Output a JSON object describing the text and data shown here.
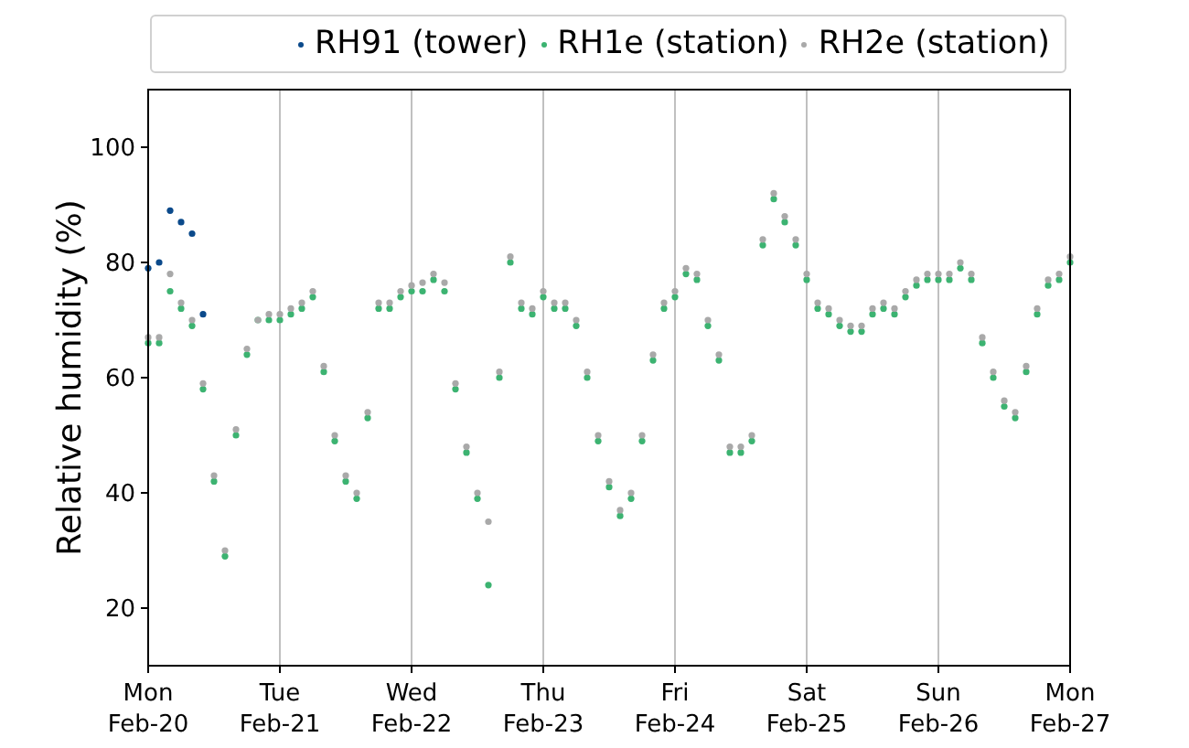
{
  "chart": {
    "chart_data": {
      "type": "scatter",
      "grid": "x",
      "legend": "top",
      "ylabel": "Relative humidity (%)",
      "categories": [
        "Mon\nFeb-20",
        null,
        null,
        null,
        null,
        null,
        null,
        null,
        null,
        null,
        null,
        null,
        "Tue\nFeb-21",
        null,
        null,
        null,
        null,
        null,
        null,
        null,
        null,
        null,
        null,
        null,
        "Wed\nFeb-22",
        null,
        null,
        null,
        null,
        null,
        null,
        null,
        null,
        null,
        null,
        null,
        "Thu\nFeb-23",
        null,
        null,
        null,
        null,
        null,
        null,
        null,
        null,
        null,
        null,
        null,
        "Fri\nFeb-24",
        null,
        null,
        null,
        null,
        null,
        null,
        null,
        null,
        null,
        null,
        null,
        "Sat\nFeb-25",
        null,
        null,
        null,
        null,
        null,
        null,
        null,
        null,
        null,
        null,
        null,
        "Sun\nFeb-26",
        null,
        null,
        null,
        null,
        null,
        null,
        null,
        null,
        null,
        null,
        null,
        "Mon\nFeb-27"
      ],
      "ylim": [
        10,
        110
      ],
      "yticks": [
        20,
        40,
        60,
        80,
        100
      ],
      "series": [
        {
          "name": "RH91 (tower)",
          "color": "#0b4a8b",
          "values": [
            79,
            80,
            89,
            87,
            85,
            71,
            null,
            null,
            null,
            null,
            null,
            null,
            null,
            null,
            null,
            null,
            null,
            null,
            null,
            null,
            null,
            null,
            null,
            null,
            null,
            null,
            null,
            null,
            null,
            null,
            null,
            null,
            null,
            null,
            null,
            null,
            null,
            null,
            null,
            null,
            null,
            null,
            null,
            null,
            null,
            null,
            null,
            null,
            null,
            null,
            null,
            null,
            null,
            null,
            null,
            null,
            null,
            null,
            null,
            null,
            null,
            null,
            null,
            null,
            null,
            null,
            null,
            null,
            null,
            null,
            null,
            null,
            null,
            null,
            null,
            null,
            null,
            null,
            null,
            null,
            null,
            null,
            null,
            null,
            null
          ]
        },
        {
          "name": "RH1e (station)",
          "color": "#3cb371",
          "values": [
            66,
            66,
            75,
            72,
            69,
            58,
            42,
            29,
            50,
            64,
            70,
            70,
            70,
            71,
            72,
            74,
            61,
            49,
            42,
            39,
            53,
            72,
            72,
            74,
            75,
            75,
            77,
            75,
            58,
            47,
            39,
            24,
            60,
            80,
            72,
            71,
            74,
            72,
            72,
            69,
            60,
            49,
            41,
            36,
            39,
            49,
            63,
            72,
            74,
            78,
            77,
            69,
            63,
            47,
            47,
            49,
            83,
            91,
            87,
            83,
            77,
            72,
            71,
            69,
            68,
            68,
            71,
            72,
            71,
            74,
            76,
            77,
            77,
            77,
            79,
            77,
            66,
            60,
            55,
            53,
            61,
            71,
            76,
            77,
            80
          ]
        },
        {
          "name": "RH2e (station)",
          "color": "#a9a9a9",
          "values": [
            67,
            67,
            78,
            73,
            70,
            59,
            43,
            30,
            51,
            65,
            70,
            71,
            71,
            72,
            73,
            75,
            62,
            50,
            43,
            40,
            54,
            73,
            73,
            75,
            76,
            76.5,
            78,
            76.5,
            59,
            48,
            40,
            35,
            61,
            81,
            73,
            72,
            75,
            73,
            73,
            70,
            61,
            50,
            42,
            37,
            40,
            50,
            64,
            73,
            75,
            79,
            78,
            70,
            64,
            48,
            48,
            50,
            84,
            92,
            88,
            84,
            78,
            73,
            72,
            70,
            69,
            69,
            72,
            73,
            72,
            75,
            77,
            78,
            78,
            78,
            80,
            78,
            67,
            61,
            56,
            54,
            62,
            72,
            77,
            78,
            81
          ]
        }
      ]
    }
  }
}
